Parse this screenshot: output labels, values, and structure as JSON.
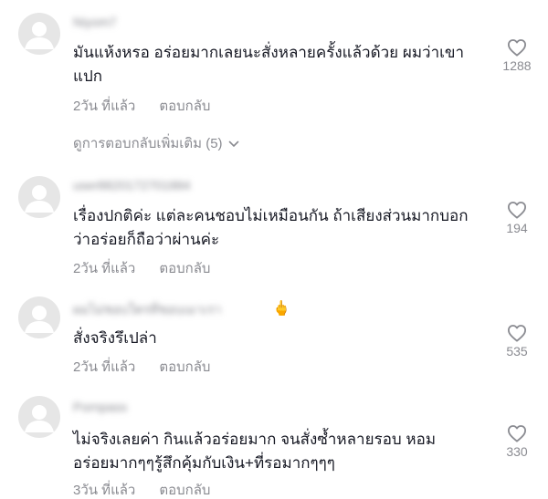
{
  "comments": [
    {
      "username": "Niyom7",
      "text": "มันแห้งหรอ อร่อยมากเลยนะสั่งหลายครั้งแล้วด้วย ผมว่าเขา\nแปก",
      "time": "2วัน ที่แล้ว",
      "reply": "ตอบกลับ",
      "likes": "1288",
      "view_replies": "ดูการตอบกลับเพิ่มเติม (5)"
    },
    {
      "username": "user8820172701884",
      "text": "เรื่องปกติค่ะ แต่ละคนชอบไม่เหมือนกัน ถ้าเสียงส่วนมากบอก\nว่าอร่อยก็ถือว่าผ่านค่ะ",
      "time": "2วัน ที่แล้ว",
      "reply": "ตอบกลับ",
      "likes": "194"
    },
    {
      "username": "ผมไม่ชอบใครที่ชอบเมาเรา",
      "emoji": "🖕",
      "text": "สั่งจริงรึเปล่า",
      "time": "2วัน ที่แล้ว",
      "reply": "ตอบกลับ",
      "likes": "535"
    },
    {
      "username": "Pornpass",
      "text": "ไม่จริงเลยค่า กินแล้วอร่อยมาก จนสั่งซ้ำหลายรอบ หอม\nอร่อยมากๆๆรู้สึกคุ้มกับเงิน+ที่รอมากๆๆๆ",
      "time": "3วัน ที่แล้ว",
      "reply": "ตอบกลับ",
      "likes": "330"
    }
  ],
  "colors": {
    "text": "#161823",
    "muted": "#8a8b91",
    "avatar_bg": "#e6e6e6",
    "avatar_fg": "#ffffff"
  },
  "icons": {
    "avatar": "default-avatar-icon",
    "like": "heart-outline-icon",
    "expand": "chevron-down-icon"
  }
}
